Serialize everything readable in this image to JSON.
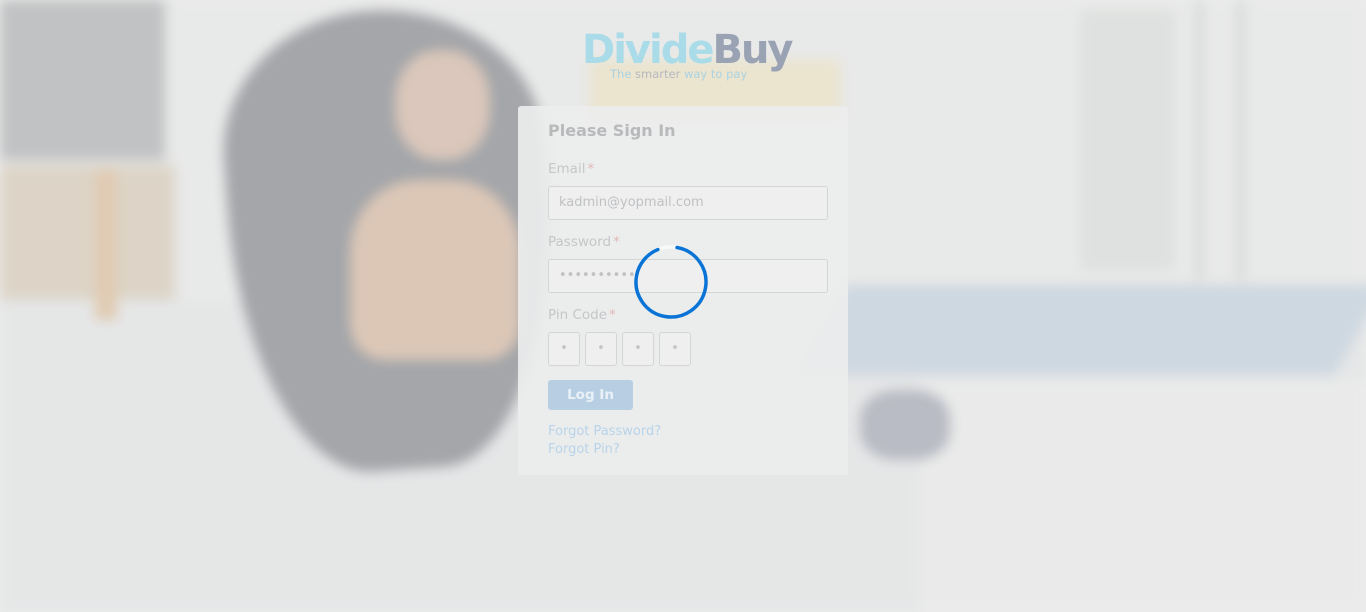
{
  "brand": {
    "logo_part1": "Divide",
    "logo_part2": "Buy",
    "tagline_part1": "The ",
    "tagline_part2": "smarter ",
    "tagline_part3": "way to pay"
  },
  "signin": {
    "title": "Please Sign In",
    "email_label": "Email",
    "email_value": "kadmin@yopmail.com",
    "password_label": "Password",
    "password_value": "••••••••••",
    "pin_label": "Pin Code",
    "pin_digits": [
      "•",
      "•",
      "•",
      "•"
    ],
    "required_mark": "*",
    "login_button": "Log In",
    "forgot_password": "Forgot Password?",
    "forgot_pin": "Forgot Pin?"
  },
  "loading": {
    "state": "loading",
    "spinner_color": "#0a74d6"
  },
  "colors": {
    "primary": "#0a74d6",
    "logo_teal": "#a9dbe8",
    "logo_slate": "#9aa3b4"
  }
}
